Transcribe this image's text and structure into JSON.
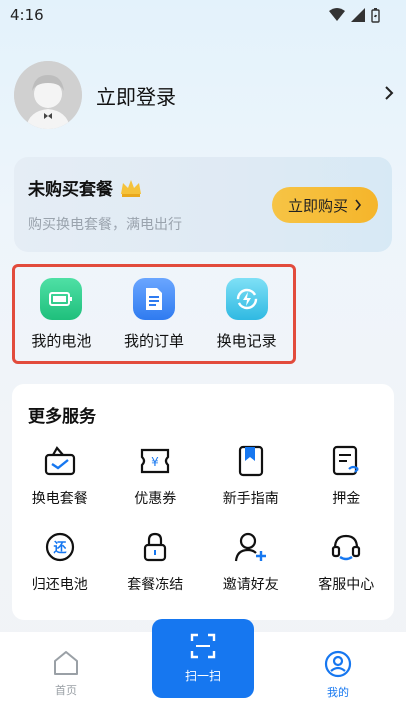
{
  "status_bar": {
    "time": "4:16"
  },
  "profile": {
    "login_label": "立即登录"
  },
  "package": {
    "title": "未购买套餐",
    "subtitle": "购买换电套餐，满电出行",
    "buy_label": "立即购买"
  },
  "quick_actions": [
    {
      "label": "我的电池",
      "icon": "battery-icon",
      "color": "#27c98a"
    },
    {
      "label": "我的订单",
      "icon": "document-icon",
      "color": "#3a86f0"
    },
    {
      "label": "换电记录",
      "icon": "swap-record-icon",
      "color": "#3cc6e8"
    }
  ],
  "more_services": {
    "title": "更多服务",
    "items": [
      {
        "label": "换电套餐",
        "icon": "package-icon"
      },
      {
        "label": "优惠券",
        "icon": "coupon-icon"
      },
      {
        "label": "新手指南",
        "icon": "book-icon"
      },
      {
        "label": "押金",
        "icon": "deposit-icon"
      },
      {
        "label": "归还电池",
        "icon": "return-icon"
      },
      {
        "label": "套餐冻结",
        "icon": "lock-icon"
      },
      {
        "label": "邀请好友",
        "icon": "invite-icon"
      },
      {
        "label": "客服中心",
        "icon": "headset-icon"
      }
    ]
  },
  "tabbar": {
    "home": "首页",
    "scan": "扫一扫",
    "mine": "我的"
  },
  "colors": {
    "accent": "#1677f0",
    "highlight_border": "#e24b3c",
    "buy_button": "#f5b52b"
  }
}
